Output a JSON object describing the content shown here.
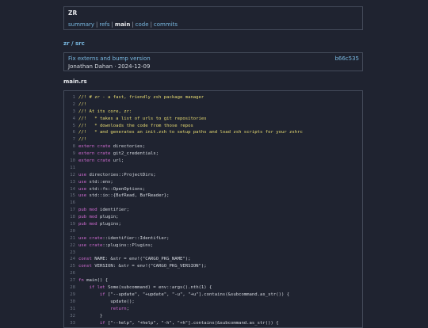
{
  "header": {
    "repo_name": "ZR",
    "nav": [
      {
        "label": "summary",
        "active": false
      },
      {
        "label": "refs",
        "active": false
      },
      {
        "label": "main",
        "active": true
      },
      {
        "label": "code",
        "active": false
      },
      {
        "label": "commits",
        "active": false
      }
    ],
    "separator": "|"
  },
  "breadcrumb": {
    "repo": "zr",
    "sep": "/",
    "dir": "src"
  },
  "commit": {
    "message": "Fix externs and bump version",
    "hash": "b66c535",
    "author": "Jonathan Dahan",
    "dot": "·",
    "date": "2024-12-09"
  },
  "file": {
    "name": "main.rs",
    "lines": [
      {
        "n": "1",
        "t": "cm",
        "s": "//! # zr - a fast, friendly zsh package manager"
      },
      {
        "n": "2",
        "t": "cm",
        "s": "//!"
      },
      {
        "n": "3",
        "t": "cm",
        "s": "//! At its core, zr:"
      },
      {
        "n": "4",
        "t": "cm",
        "s": "//!   * takes a list of urls to git repositories"
      },
      {
        "n": "5",
        "t": "cm",
        "s": "//!   * downloads the code from those repos"
      },
      {
        "n": "6",
        "t": "cm",
        "s": "//!   * and generates an init.zsh to setup paths and load zsh scripts for your zshrc"
      },
      {
        "n": "7",
        "t": "cm",
        "s": "//!"
      },
      {
        "n": "8",
        "t": "kw",
        "s": "extern crate",
        "r": " directories;"
      },
      {
        "n": "9",
        "t": "kw",
        "s": "extern crate",
        "r": " git2_credentials;"
      },
      {
        "n": "10",
        "t": "kw",
        "s": "extern crate",
        "r": " url;"
      },
      {
        "n": "11",
        "t": "tx",
        "s": ""
      },
      {
        "n": "12",
        "t": "kw",
        "s": "use",
        "r": " directories::ProjectDirs;"
      },
      {
        "n": "13",
        "t": "kw",
        "s": "use",
        "r": " std::env;"
      },
      {
        "n": "14",
        "t": "kw",
        "s": "use",
        "r": " std::fs::OpenOptions;"
      },
      {
        "n": "15",
        "t": "kw",
        "s": "use",
        "r": " std::io::{BufRead, BufReader};"
      },
      {
        "n": "16",
        "t": "tx",
        "s": ""
      },
      {
        "n": "17",
        "t": "kw",
        "s": "pub mod",
        "r": " identifier;"
      },
      {
        "n": "18",
        "t": "kw",
        "s": "pub mod",
        "r": " plugin;"
      },
      {
        "n": "19",
        "t": "kw",
        "s": "pub mod",
        "r": " plugins;"
      },
      {
        "n": "20",
        "t": "tx",
        "s": ""
      },
      {
        "n": "21",
        "t": "kw",
        "s": "use crate",
        "r": "::identifier::Identifier;"
      },
      {
        "n": "22",
        "t": "kw",
        "s": "use crate",
        "r": "::plugins::Plugins;"
      },
      {
        "n": "23",
        "t": "tx",
        "s": ""
      },
      {
        "n": "24",
        "t": "kw",
        "s": "const",
        "r": " NAME: &str = env!(\"CARGO_PKG_NAME\");"
      },
      {
        "n": "25",
        "t": "kw",
        "s": "const",
        "r": " VERSION: &str = env!(\"CARGO_PKG_VERSION\");"
      },
      {
        "n": "26",
        "t": "tx",
        "s": ""
      },
      {
        "n": "27",
        "t": "kw",
        "s": "fn",
        "r": " main() {"
      },
      {
        "n": "28",
        "t": "kw",
        "s": "    if let",
        "r": " Some(subcommand) = env::args().nth(1) {"
      },
      {
        "n": "29",
        "t": "kw",
        "s": "        if",
        "r": " [\"--update\", \"+update\", \"-u\", \"+u\"].contains(&subcommand.as_str()) {"
      },
      {
        "n": "30",
        "t": "tx",
        "s": "            update();"
      },
      {
        "n": "31",
        "t": "kw",
        "s": "            return",
        "r": ";"
      },
      {
        "n": "32",
        "t": "tx",
        "s": "        }"
      },
      {
        "n": "33",
        "t": "kw",
        "s": "        if",
        "r": " [\"--help\", \"+help\", \"-h\", \"+h\"].contains(&subcommand.as_str()) {"
      }
    ]
  }
}
